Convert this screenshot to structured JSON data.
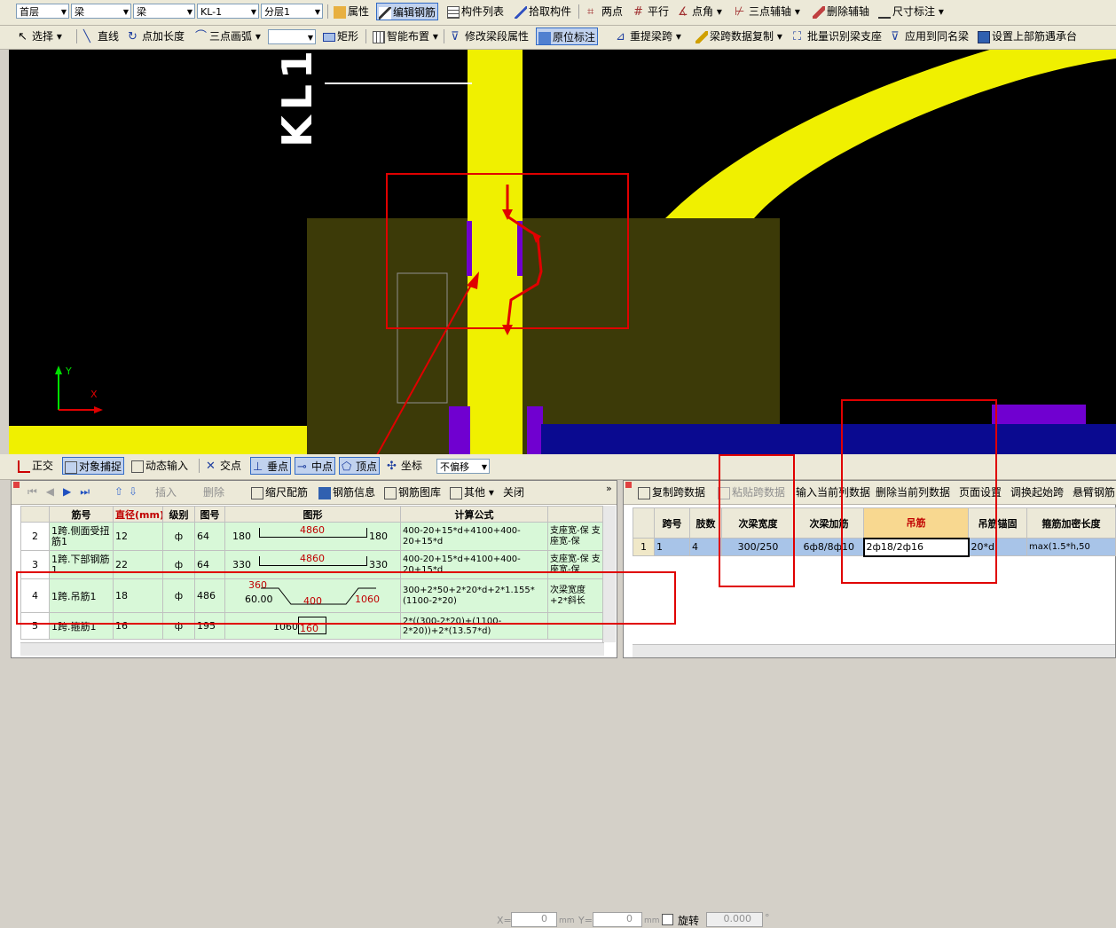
{
  "toolbar1": {
    "floor": "首层",
    "type1": "梁",
    "type2": "梁",
    "element": "KL-1",
    "layer": "分层1",
    "properties": "属性",
    "edit_rebar": "编辑钢筋",
    "component_list": "构件列表",
    "pick_component": "拾取构件",
    "two_points": "两点",
    "parallel": "平行",
    "point_angle": "点角",
    "three_point_axis": "三点辅轴",
    "delete_axis": "删除辅轴",
    "dimension": "尺寸标注"
  },
  "toolbar2": {
    "select": "选择",
    "line": "直线",
    "point_length": "点加长度",
    "three_point_arc": "三点画弧",
    "rectangle": "矩形",
    "smart_layout": "智能布置",
    "modify_beam_span_attr": "修改梁段属性",
    "in_situ_label": "原位标注",
    "repick_span": "重提梁跨",
    "copy_span_data": "梁跨数据复制",
    "batch_identify": "批量识别梁支座",
    "apply_same_name": "应用到同名梁",
    "set_top_rebar": "设置上部筋遇承台"
  },
  "canvas": {
    "label_text": "KL1",
    "axis_y": "Y",
    "axis_x": "X"
  },
  "statusbar": {
    "ortho": "正交",
    "snap": "对象捕捉",
    "dynamic_input": "动态输入",
    "intersection": "交点",
    "perpendicular": "垂点",
    "midpoint": "中点",
    "vertex": "顶点",
    "coordinate": "坐标",
    "offset_mode": "不偏移",
    "x_label": "X=",
    "x_value": "0",
    "y_label": "Y=",
    "y_value": "0",
    "unit": "mm",
    "rotate": "旋转",
    "rotate_value": "0.000",
    "degree": "°"
  },
  "left_panel": {
    "toolbar": {
      "insert": "插入",
      "delete": "删除",
      "scale_rebar": "缩尺配筋",
      "rebar_info": "钢筋信息",
      "rebar_library": "钢筋图库",
      "other": "其他",
      "close": "关闭"
    },
    "headers": [
      "",
      "筋号",
      "直径(mm)",
      "级别",
      "图号",
      "图形",
      "计算公式",
      ""
    ],
    "rows": [
      {
        "no": "2",
        "name": "1跨.侧面受扭筋1",
        "dia": "12",
        "grade": "ф",
        "fig": "64",
        "shape_left": "180",
        "shape_mid": "4860",
        "shape_right": "180",
        "formula": "400-20+15*d+4100+400-20+15*d",
        "desc": "支座宽-保 支座宽-保"
      },
      {
        "no": "3",
        "name": "1跨.下部钢筋1",
        "dia": "22",
        "grade": "ф",
        "fig": "64",
        "shape_left": "330",
        "shape_mid": "4860",
        "shape_right": "330",
        "formula": "400-20+15*d+4100+400-20+15*d",
        "desc": "支座宽-保 支座宽-保"
      },
      {
        "no": "4",
        "name": "1跨.吊筋1",
        "dia": "18",
        "grade": "ф",
        "fig": "486",
        "shape_a": "360",
        "shape_b": "60.00",
        "shape_c": "400",
        "shape_d": "1060",
        "formula": "300+2*50+2*20*d+2*1.155*(1100-2*20)",
        "desc": "次梁宽度+2*斜长"
      },
      {
        "no": "5",
        "name": "1跨.箍筋1",
        "dia": "16",
        "grade": "ф",
        "fig": "195",
        "shape_a": "1060",
        "shape_b": "160",
        "formula": "2*((300-2*20)+(1100-2*20))+2*(13.57*d)",
        "desc": ""
      }
    ]
  },
  "right_panel": {
    "toolbar": {
      "copy_span": "复制跨数据",
      "paste_span": "粘贴跨数据",
      "input_current": "输入当前列数据",
      "delete_current": "删除当前列数据",
      "page_setup": "页面设置",
      "swap_start": "调换起始跨",
      "cantilever": "悬臂钢筋"
    },
    "headers": [
      "",
      "跨号",
      "肢数",
      "次梁宽度",
      "次梁加筋",
      "吊筋",
      "吊筋锚固",
      "箍筋加密长度"
    ],
    "row": {
      "idx": "1",
      "span": "1",
      "legs": "4",
      "width": "300/250",
      "extra": "6ф8/8ф10",
      "hanger": "2ф18/2ф16",
      "anchor": "20*d",
      "dense": "max(1.5*h,50"
    }
  }
}
